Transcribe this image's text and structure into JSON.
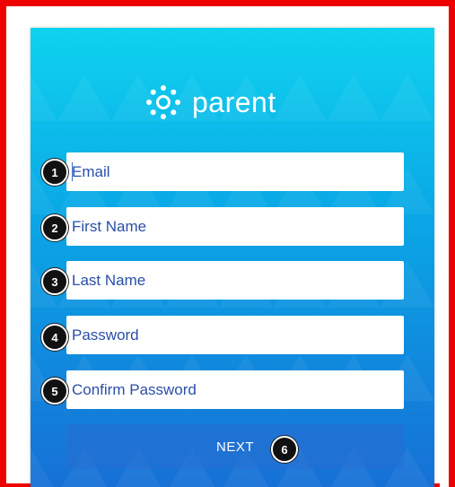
{
  "brand": {
    "icon": "canvas-logo-icon",
    "name": "parent"
  },
  "form": {
    "email": {
      "placeholder": "Email",
      "value": ""
    },
    "first_name": {
      "placeholder": "First Name",
      "value": ""
    },
    "last_name": {
      "placeholder": "Last Name",
      "value": ""
    },
    "password": {
      "placeholder": "Password",
      "value": ""
    },
    "confirm_password": {
      "placeholder": "Confirm Password",
      "value": ""
    },
    "next_label": "NEXT"
  },
  "callouts": [
    "1",
    "2",
    "3",
    "4",
    "5",
    "6"
  ],
  "colors": {
    "frame": "#ee0000",
    "gradient_top": "#0fd3ef",
    "gradient_bottom": "#1670d6",
    "field_text": "#2a4fa8",
    "button": "#286ed2"
  }
}
